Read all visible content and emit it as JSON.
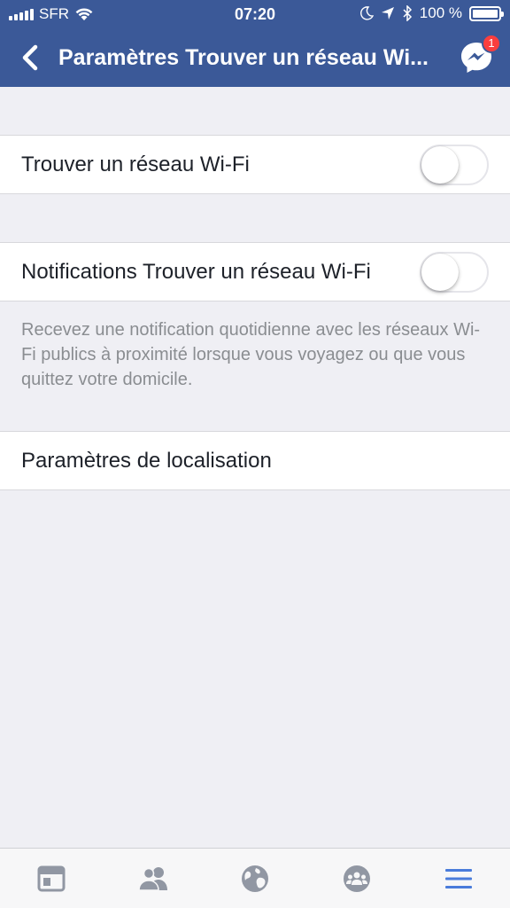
{
  "status_bar": {
    "carrier": "SFR",
    "time": "07:20",
    "battery": "100 %"
  },
  "nav": {
    "title": "Paramètres Trouver un réseau Wi...",
    "messenger_badge": "1"
  },
  "settings": {
    "find_wifi_label": "Trouver un réseau Wi-Fi",
    "find_wifi_on": false,
    "notifications_label": "Notifications Trouver un réseau Wi-Fi",
    "notifications_on": false,
    "notifications_description": "Recevez une notification quotidienne avec les réseaux Wi-Fi publics à proximité lorsque vous voyagez ou que vous quittez votre domicile.",
    "location_label": "Paramètres de localisation"
  },
  "tab_bar": {
    "tabs": [
      {
        "icon": "news-feed-icon",
        "active": false
      },
      {
        "icon": "friends-icon",
        "active": false
      },
      {
        "icon": "globe-icon",
        "active": false
      },
      {
        "icon": "groups-icon",
        "active": false
      },
      {
        "icon": "menu-icon",
        "active": true
      }
    ]
  },
  "colors": {
    "header": "#3b5998",
    "background": "#efeff4",
    "active_tab": "#4a7cdb",
    "inactive_tab": "#9197a3",
    "badge": "#fa3e3e"
  }
}
